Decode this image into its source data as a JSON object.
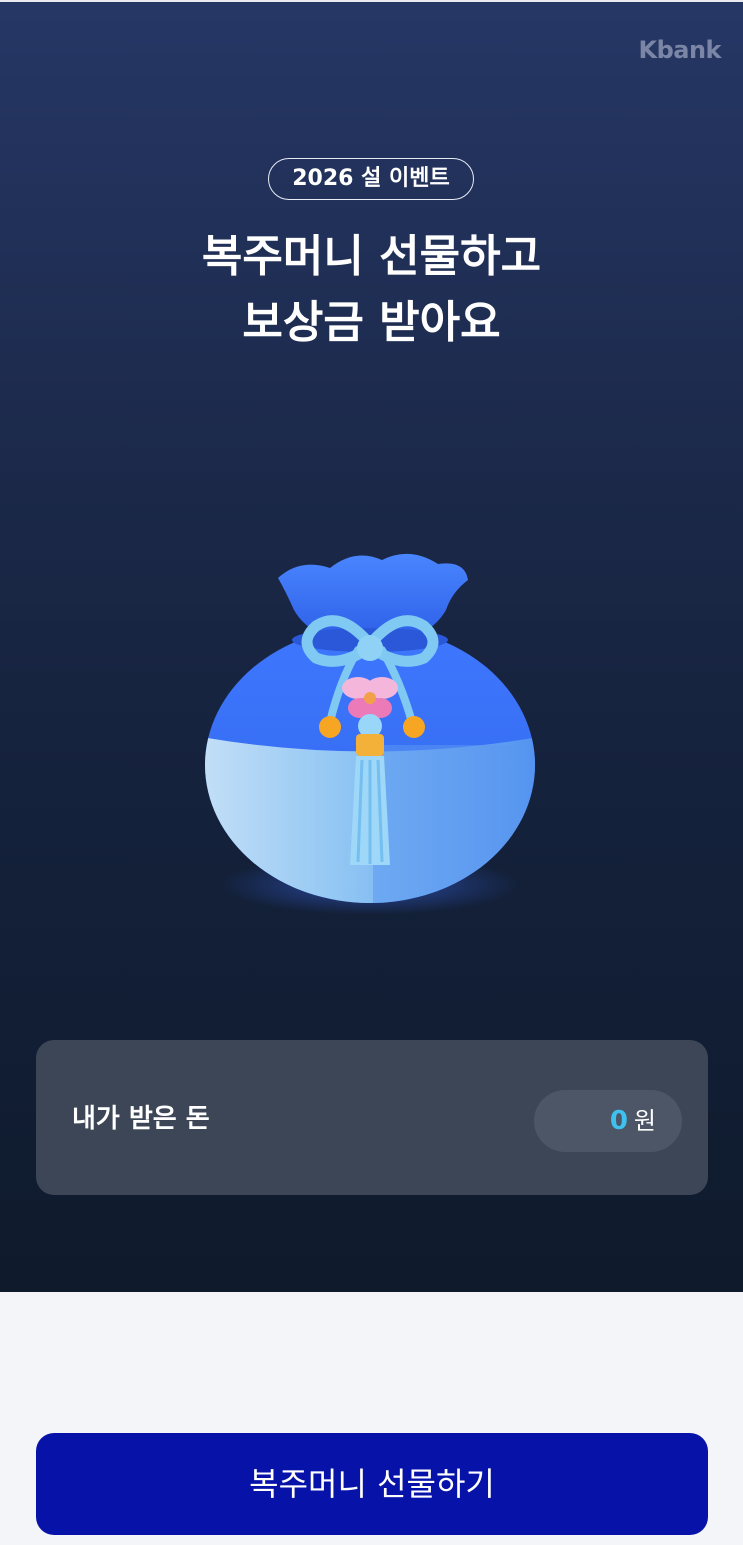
{
  "header": {
    "brand_logo": "Kbank"
  },
  "hero": {
    "badge": "2026 설 이벤트",
    "title_line1": "복주머니 선물하고",
    "title_line2": "보상금 받아요",
    "illustration": "lucky-pouch-illustration"
  },
  "received_money": {
    "label": "내가 받은 돈",
    "amount": "0",
    "unit": "원"
  },
  "cta": {
    "label": "복주머니 선물하기"
  },
  "colors": {
    "hero_top": "#263766",
    "hero_bottom": "#0f1a2c",
    "card_bg": "#3c4656",
    "amount_accent": "#3fc1f0",
    "cta_bg": "#0713a8",
    "page_bg": "#f4f5f9"
  }
}
